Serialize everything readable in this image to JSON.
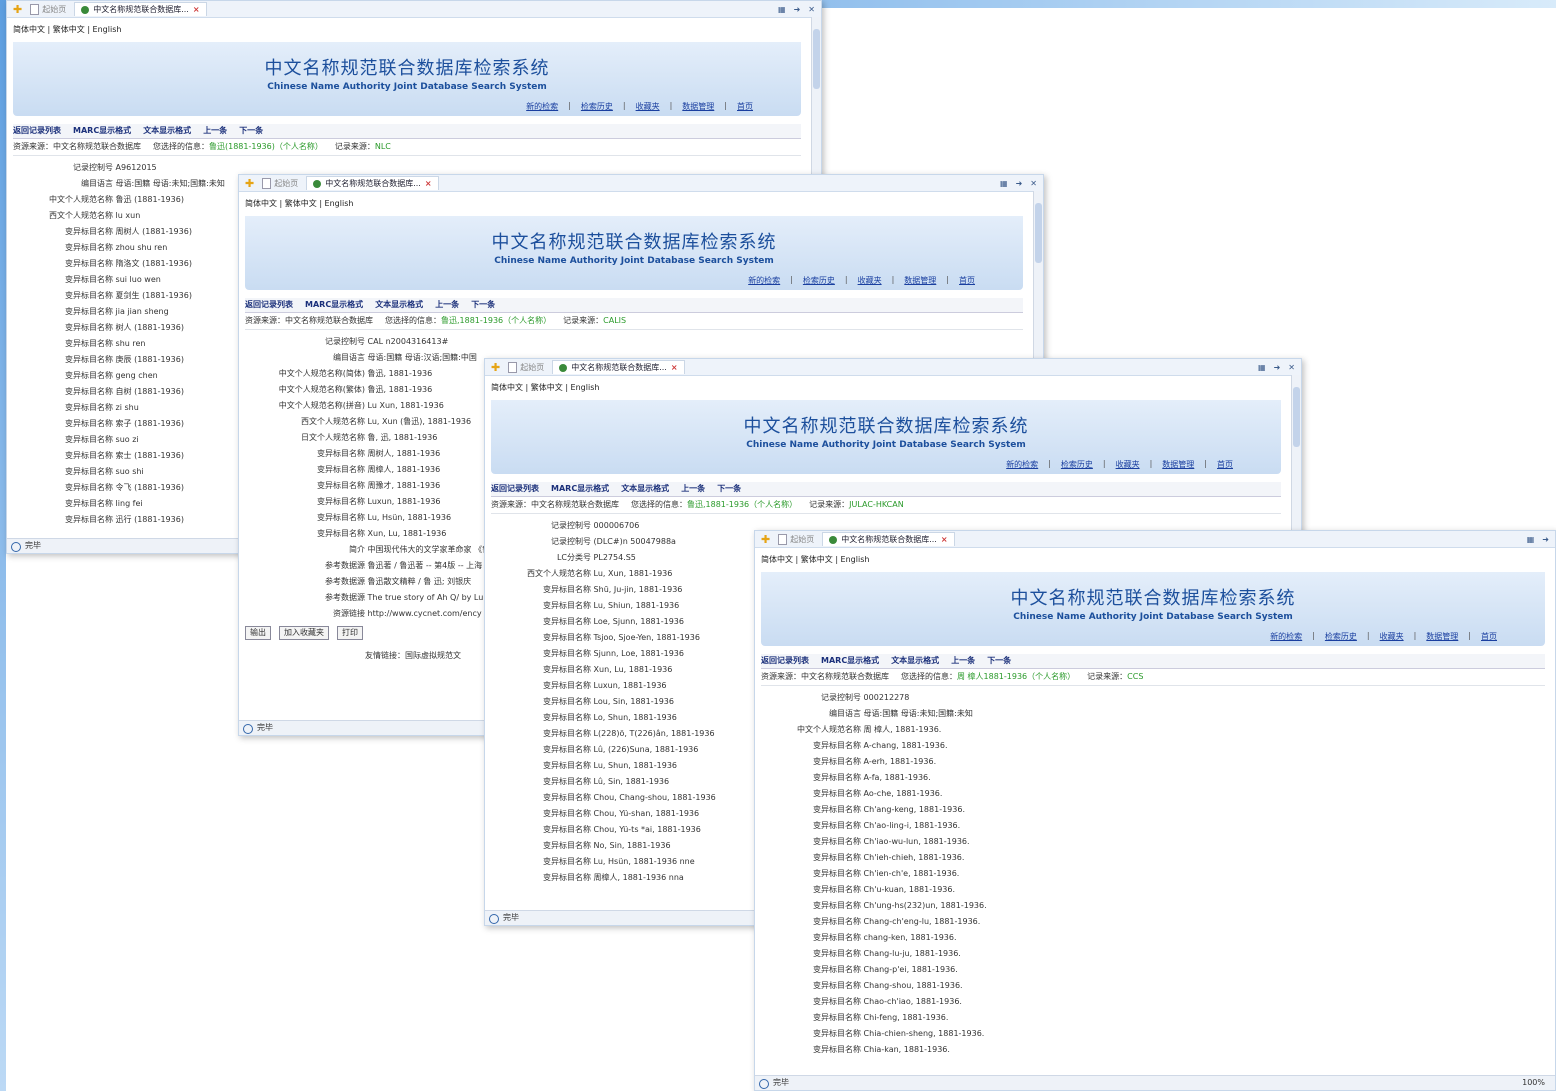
{
  "common": {
    "tab_home": "起始页",
    "tab_title": "中文名称规范联合数据库...",
    "languages": "简体中文 | 繁体中文 | English",
    "banner_title": "中文名称规范联合数据库检索系统",
    "banner_subtitle": "Chinese Name Authority Joint Database Search System",
    "links": [
      "新的检索",
      "检索历史",
      "收藏夹",
      "数据管理",
      "首页"
    ],
    "nav": [
      "返回记录列表",
      "MARC显示格式",
      "文本显示格式",
      "上一条",
      "下一条"
    ],
    "source_label": "资源来源：中文名称规范联合数据库",
    "selected_label": "您选择的信息：",
    "record_source_label": "记录来源：",
    "status": "完毕"
  },
  "windows": [
    {
      "selected": "鲁迅(1881-1936)（个人名称）",
      "record_source": "NLC",
      "rows": [
        [
          "记录控制号",
          "A9612015"
        ],
        [
          "编目语言",
          "母语:国籍 母语:未知;国籍:未知"
        ],
        [
          "中文个人规范名称",
          "鲁迅 (1881-1936)"
        ],
        [
          "西文个人规范名称",
          "lu xun"
        ],
        [
          "变异标目名称",
          "周树人 (1881-1936)"
        ],
        [
          "变异标目名称",
          "zhou shu ren"
        ],
        [
          "变异标目名称",
          "隋洛文 (1881-1936)"
        ],
        [
          "变异标目名称",
          "sui luo wen"
        ],
        [
          "变异标目名称",
          "夏剑生 (1881-1936)"
        ],
        [
          "变异标目名称",
          "jia jian sheng"
        ],
        [
          "变异标目名称",
          "树人 (1881-1936)"
        ],
        [
          "变异标目名称",
          "shu ren"
        ],
        [
          "变异标目名称",
          "庚辰 (1881-1936)"
        ],
        [
          "变异标目名称",
          "geng chen"
        ],
        [
          "变异标目名称",
          "自树 (1881-1936)"
        ],
        [
          "变异标目名称",
          "zi shu"
        ],
        [
          "变异标目名称",
          "索子 (1881-1936)"
        ],
        [
          "变异标目名称",
          "suo zi"
        ],
        [
          "变异标目名称",
          "索士 (1881-1936)"
        ],
        [
          "变异标目名称",
          "suo shi"
        ],
        [
          "变异标目名称",
          "令飞 (1881-1936)"
        ],
        [
          "变异标目名称",
          "ling fei"
        ],
        [
          "变异标目名称",
          "迅行 (1881-1936)"
        ]
      ]
    },
    {
      "selected": "鲁迅,1881-1936（个人名称）",
      "record_source": "CALIS",
      "rows": [
        [
          "记录控制号",
          "CAL n2004316413#"
        ],
        [
          "编目语言",
          "母语:国籍 母语:汉语;国籍:中国"
        ],
        [
          "中文个人规范名称(简体)",
          "鲁迅, 1881-1936"
        ],
        [
          "中文个人规范名称(繁体)",
          "鲁迅, 1881-1936"
        ],
        [
          "中文个人规范名称(拼音)",
          "Lu Xun, 1881-1936"
        ],
        [
          "西文个人规范名称",
          "Lu, Xun (鲁迅), 1881-1936"
        ],
        [
          "日文个人规范名称",
          "鲁, 迅, 1881-1936"
        ],
        [
          "变异标目名称",
          "周树人, 1881-1936"
        ],
        [
          "变异标目名称",
          "周樟人, 1881-1936"
        ],
        [
          "变异标目名称",
          "周豫才, 1881-1936"
        ],
        [
          "变异标目名称",
          "Luxun, 1881-1936"
        ],
        [
          "变异标目名称",
          "Lu, Hsün, 1881-1936"
        ],
        [
          "变异标目名称",
          "Xun, Lu, 1881-1936"
        ],
        [
          "简介",
          "中国现代伟大的文学家革命家 《鲁迅小说集》等。"
        ],
        [
          "参考数据源",
          "鲁迅著 / 鲁迅著 -- 第4版 -- 上海"
        ],
        [
          "参考数据源",
          "鲁迅散文精粹 / 鲁 迅; 刘银庆"
        ],
        [
          "参考数据源",
          "The true story of Ah Q/ by Lu"
        ],
        [
          "资源链接",
          "http://www.cycnet.com/ency"
        ]
      ],
      "buttons": [
        "输出",
        "加入收藏夹",
        "打印"
      ],
      "friendly_label": "友情链接：",
      "friendly_value": "国际虚拟规范文"
    },
    {
      "selected": "鲁迅,1881-1936（个人名称）",
      "record_source": "JULAC-HKCAN",
      "rows": [
        [
          "记录控制号",
          "000006706"
        ],
        [
          "记录控制号",
          "(DLC#)n 50047988a"
        ],
        [
          "LC分类号",
          "PL2754.S5"
        ],
        [
          "西文个人规范名称",
          "Lu, Xun, 1881-1936"
        ],
        [
          "变异标目名称",
          "Shū, Ju-jin, 1881-1936"
        ],
        [
          "变异标目名称",
          "Lu, Shiun, 1881-1936"
        ],
        [
          "变异标目名称",
          "Loe, Sjunn, 1881-1936"
        ],
        [
          "变异标目名称",
          "Tsjoo, Sjoe-Yen, 1881-1936"
        ],
        [
          "变异标目名称",
          "Sjunn, Loe, 1881-1936"
        ],
        [
          "变异标目名称",
          "Xun, Lu, 1881-1936"
        ],
        [
          "变异标目名称",
          "Luxun, 1881-1936"
        ],
        [
          "变异标目名称",
          "Lou, Sin, 1881-1936"
        ],
        [
          "变异标目名称",
          "Lo, Shun, 1881-1936"
        ],
        [
          "变异标目名称",
          "L(228)ö, T(226)ân, 1881-1936"
        ],
        [
          "变异标目名称",
          "Lû, (226)Suna, 1881-1936"
        ],
        [
          "变异标目名称",
          "Lu, Shun, 1881-1936"
        ],
        [
          "变异标目名称",
          "Lû, Sin, 1881-1936"
        ],
        [
          "变异标目名称",
          "Chou, Chang-shou, 1881-1936"
        ],
        [
          "变异标目名称",
          "Chou, Yü-shan, 1881-1936"
        ],
        [
          "变异标目名称",
          "Chou, Yü-ts *ai, 1881-1936"
        ],
        [
          "变异标目名称",
          "No, Sin, 1881-1936"
        ],
        [
          "变异标目名称",
          "Lu, Hsün, 1881-1936 nne"
        ],
        [
          "变异标目名称",
          "周樟人, 1881-1936 nna"
        ]
      ]
    },
    {
      "selected": "周 樟人1881-1936（个人名称）",
      "record_source": "CCS",
      "zoom": "100%",
      "rows": [
        [
          "记录控制号",
          "000212278"
        ],
        [
          "编目语言",
          "母语:国籍 母语:未知;国籍:未知"
        ],
        [
          "中文个人规范名称",
          "周 樟人, 1881-1936."
        ],
        [
          "变异标目名称",
          "A-chang, 1881-1936."
        ],
        [
          "变异标目名称",
          "A-erh, 1881-1936."
        ],
        [
          "变异标目名称",
          "A-fa, 1881-1936."
        ],
        [
          "变异标目名称",
          "Ao-che, 1881-1936."
        ],
        [
          "变异标目名称",
          "Ch'ang-keng, 1881-1936."
        ],
        [
          "变异标目名称",
          "Ch'ao-ling-i, 1881-1936."
        ],
        [
          "变异标目名称",
          "Ch'iao-wu-lun, 1881-1936."
        ],
        [
          "变异标目名称",
          "Ch'ieh-chieh, 1881-1936."
        ],
        [
          "变异标目名称",
          "Ch'ien-ch'e, 1881-1936."
        ],
        [
          "变异标目名称",
          "Ch'u-kuan, 1881-1936."
        ],
        [
          "变异标目名称",
          "Ch'ung-hs(232)un, 1881-1936."
        ],
        [
          "变异标目名称",
          "Chang-ch'eng-lu, 1881-1936."
        ],
        [
          "变异标目名称",
          "chang-ken, 1881-1936."
        ],
        [
          "变异标目名称",
          "Chang-lu-ju, 1881-1936."
        ],
        [
          "变异标目名称",
          "Chang-p'ei, 1881-1936."
        ],
        [
          "变异标目名称",
          "Chang-shou, 1881-1936."
        ],
        [
          "变异标目名称",
          "Chao-ch'iao, 1881-1936."
        ],
        [
          "变异标目名称",
          "Chi-feng, 1881-1936."
        ],
        [
          "变异标目名称",
          "Chia-chien-sheng, 1881-1936."
        ],
        [
          "变异标目名称",
          "Chia-kan, 1881-1936."
        ]
      ]
    }
  ]
}
